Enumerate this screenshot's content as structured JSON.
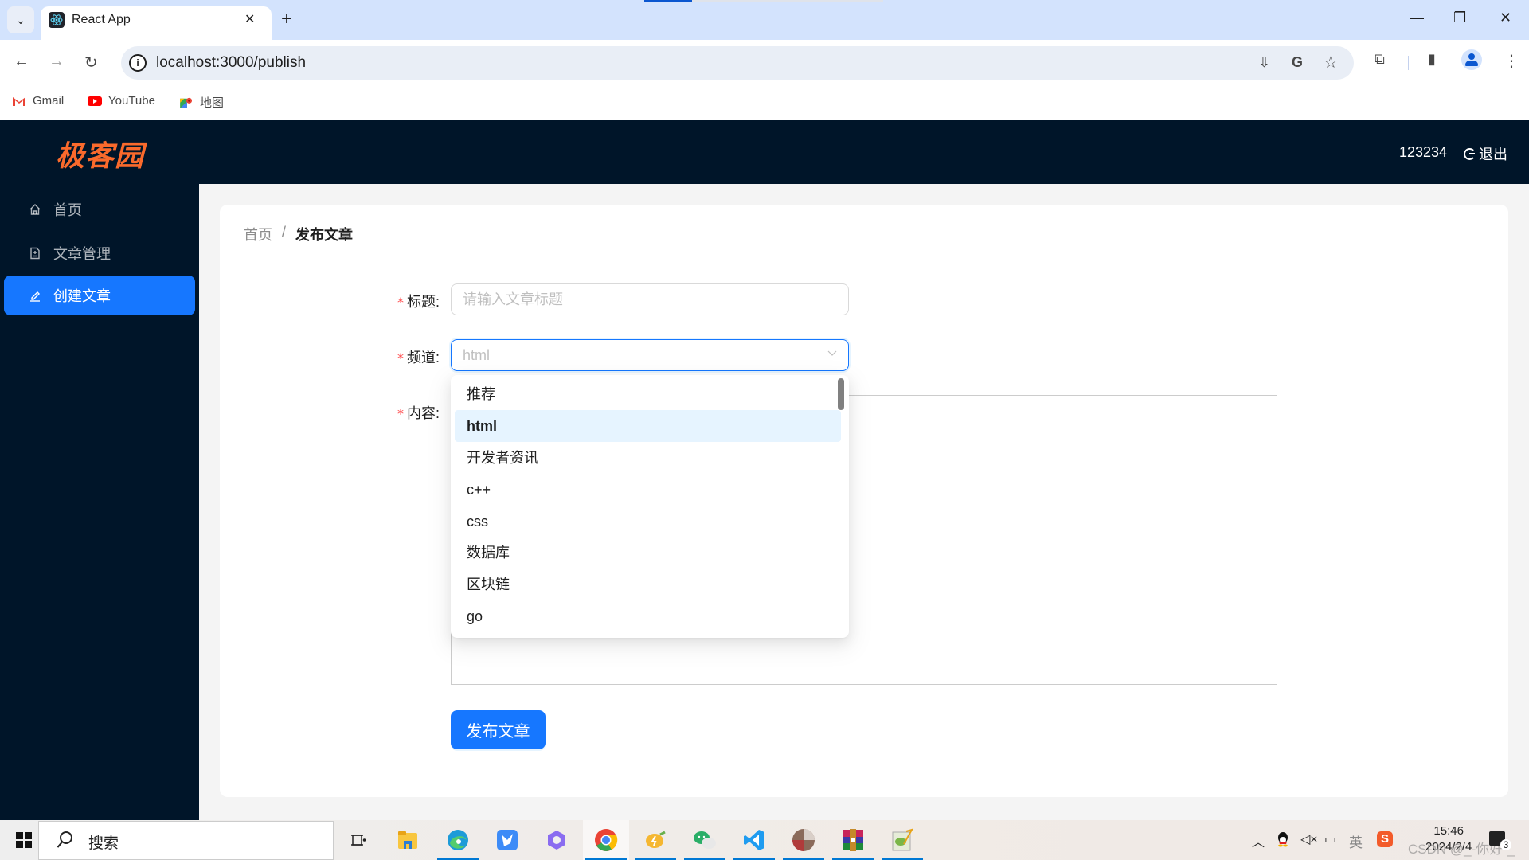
{
  "browser": {
    "tab_title": "React App",
    "url": "localhost:3000/publish",
    "bookmarks": [
      {
        "label": "Gmail",
        "icon": "gmail-icon"
      },
      {
        "label": "YouTube",
        "icon": "youtube-icon"
      },
      {
        "label": "地图",
        "icon": "maps-icon"
      }
    ],
    "icons": {
      "tab_list": "⌄",
      "close": "✕",
      "new_tab": "+",
      "back": "←",
      "forward": "→",
      "reload": "↻",
      "info": "i",
      "install": "⇩",
      "translate": "G",
      "bookmark": "☆",
      "extensions": "⧉",
      "side_panel": "▮",
      "menu": "⋮",
      "minimize": "—",
      "restore": "❐",
      "window_close": "✕"
    }
  },
  "app": {
    "logo": "极客园",
    "user_name": "123234",
    "logout_label": "退出",
    "brand_color": "#fa6a2c",
    "primary_color": "#1677ff",
    "menu": [
      {
        "label": "首页",
        "icon": "home-icon",
        "active": false
      },
      {
        "label": "文章管理",
        "icon": "file-icon",
        "active": false
      },
      {
        "label": "创建文章",
        "icon": "edit-icon",
        "active": true
      }
    ],
    "breadcrumb": [
      {
        "label": "首页"
      },
      {
        "label": "发布文章"
      }
    ],
    "breadcrumb_separator": "/",
    "form": {
      "title_label": "标题",
      "title_placeholder": "请输入文章标题",
      "title_value": "",
      "channel_label": "频道",
      "channel_value": "html",
      "content_label": "内容",
      "colon": ":",
      "required_mark": "*",
      "submit_label": "发布文章"
    },
    "channel_options": [
      {
        "label": "推荐",
        "selected": false
      },
      {
        "label": "html",
        "selected": true
      },
      {
        "label": "开发者资讯",
        "selected": false
      },
      {
        "label": "c++",
        "selected": false
      },
      {
        "label": "css",
        "selected": false
      },
      {
        "label": "数据库",
        "selected": false
      },
      {
        "label": "区块链",
        "selected": false
      },
      {
        "label": "go",
        "selected": false
      }
    ]
  },
  "taskbar": {
    "search_label": "搜索",
    "apps": [
      "task-view",
      "file-explorer",
      "edge",
      "feishu",
      "microsoft-365",
      "chrome",
      "lemon-app",
      "wechat",
      "vscode",
      "photos",
      "winrar",
      "notepad-plus-plus"
    ],
    "time": "15:46",
    "date": "2024/2/4",
    "input_method": "英",
    "notification_count": "3",
    "watermark": "CSDN @_-你好-_"
  }
}
